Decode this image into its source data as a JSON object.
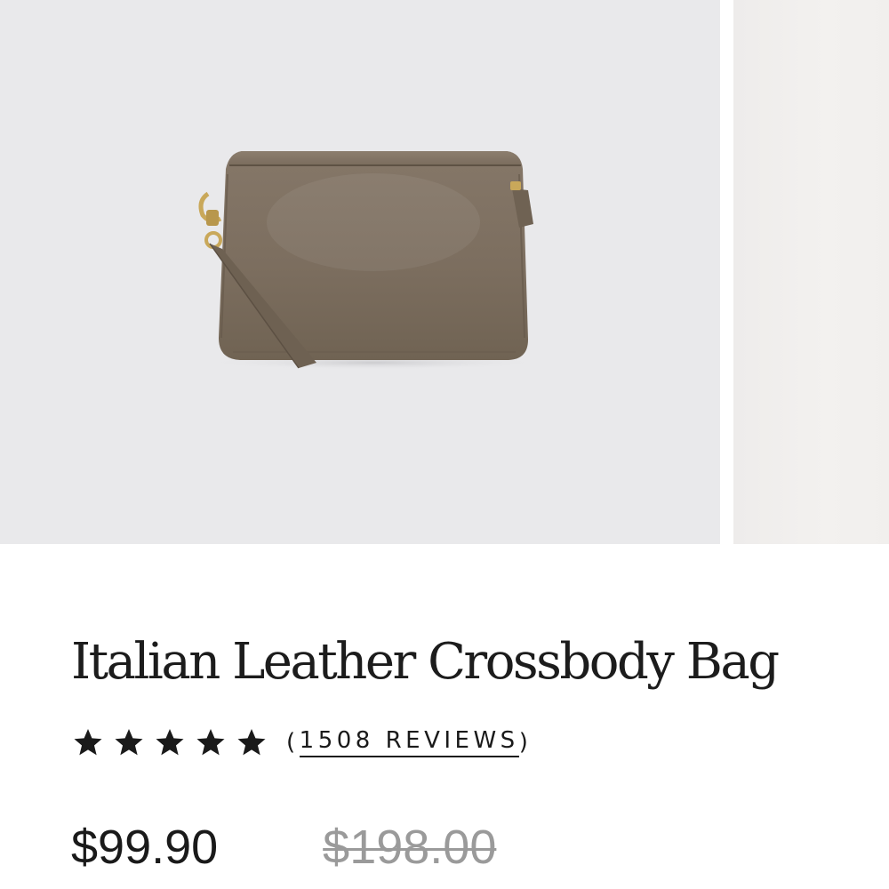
{
  "product": {
    "title": "Italian Leather Crossbody Bag",
    "image_subject": "bag-image",
    "rating": {
      "stars": 5,
      "max": 5,
      "reviews_open": "(",
      "reviews_text": "1508 REVIEWS",
      "reviews_close": ")"
    },
    "price": {
      "current": "$99.90",
      "original": "$198.00"
    }
  },
  "colors": {
    "image_background": "#e9e9eb",
    "bag_leather": "#7c6e5f",
    "hardware_gold": "#c9a85a",
    "text_primary": "#1a1a1a",
    "text_muted": "#9a9a9a"
  }
}
